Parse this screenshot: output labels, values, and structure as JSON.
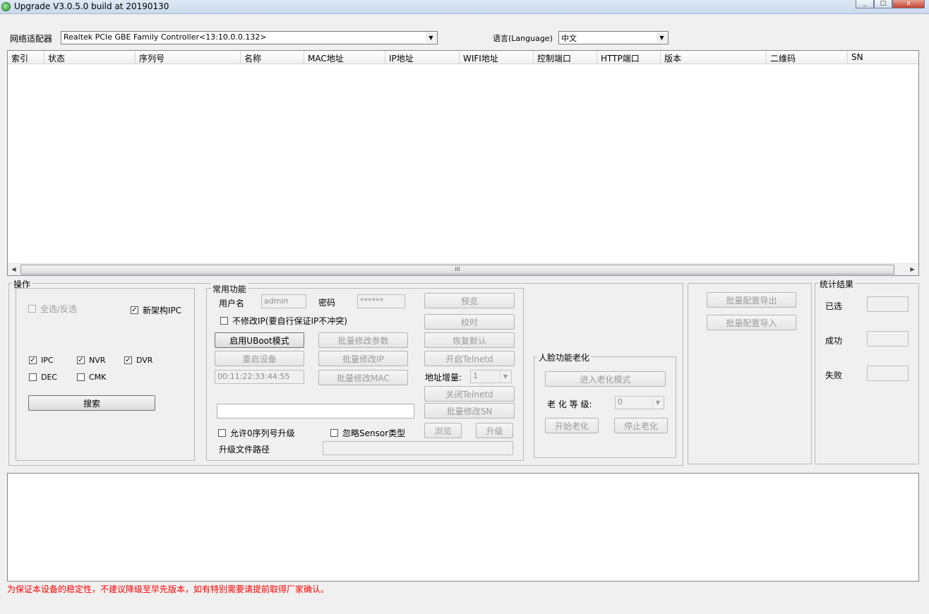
{
  "window": {
    "title": "Upgrade V3.0.5.0 build at 20190130",
    "controls": [
      "_",
      "□",
      "x"
    ]
  },
  "adapter": {
    "label": "网络适配器",
    "value": "Realtek PCIe GBE Family Controller<13:10.0.0.132>"
  },
  "language": {
    "label": "语言(Language)",
    "value": "中文"
  },
  "device_table": {
    "columns": [
      "索引",
      "状态",
      "序列号",
      "名称",
      "MAC地址",
      "IP地址",
      "WIFI地址",
      "控制端口",
      "HTTP端口",
      "版本",
      "二维码",
      "SN"
    ],
    "rows": [],
    "scroll_thumb_glyph": "III"
  },
  "operations": {
    "title": "操作",
    "select_all": {
      "label": "全选/反选",
      "checked": false,
      "enabled": false
    },
    "new_arch_ipc": {
      "label": "新架构IPC",
      "checked": true
    },
    "types": [
      {
        "label": "IPC",
        "checked": true
      },
      {
        "label": "NVR",
        "checked": true
      },
      {
        "label": "DVR",
        "checked": true
      },
      {
        "label": "DEC",
        "checked": false
      },
      {
        "label": "CMK",
        "checked": false
      }
    ],
    "search_button": "搜索"
  },
  "common": {
    "title": "常用功能",
    "username_label": "用户名",
    "username_value": "admin",
    "password_label": "密码",
    "password_value": "******",
    "no_modify_ip": {
      "label": "不修改IP(要自行保证IP不冲突)",
      "checked": false
    },
    "uboot_button": "启用UBoot模式",
    "batch_params_button": "批量修改参数",
    "restart_button": "重启设备",
    "batch_ip_button": "批量修改IP",
    "mac_value": "00:11:22:33:44:55",
    "batch_mac_button": "批量修改MAC",
    "preview_button": "预览",
    "sync_time_button": "校时",
    "restore_button": "恢复默认",
    "telnet_on_button": "开启Telnetd",
    "addr_increment_label": "地址增量:",
    "addr_increment_value": "1",
    "telnet_off_button": "关闭Telnetd",
    "batch_sn_button": "批量修改SN",
    "progress_value": "",
    "allow_zero_sn": {
      "label": "允许0序列号升级",
      "checked": false
    },
    "ignore_sensor": {
      "label": "忽略Sensor类型",
      "checked": false
    },
    "browse_button": "浏览",
    "upgrade_button": "升级",
    "file_path_label": "升级文件路径",
    "file_path_value": ""
  },
  "aging": {
    "title": "人脸功能老化",
    "enter_button": "进入老化模式",
    "level_label": "老 化 等 级:",
    "level_value": "0",
    "start_button": "开始老化",
    "stop_button": "停止老化"
  },
  "batch_config": {
    "export_button": "批量配置导出",
    "import_button": "批量配置导入"
  },
  "stats": {
    "title": "统计结果",
    "selected_label": "已选",
    "success_label": "成功",
    "fail_label": "失败",
    "selected_value": "",
    "success_value": "",
    "fail_value": ""
  },
  "log": {
    "text": ""
  },
  "warning_text": "为保证本设备的稳定性，不建议降级至早先版本，如有特别需要请提前取得厂家确认。",
  "colors": {
    "warning": "#ff0000",
    "background": "#f0f0f0",
    "disabled_text": "#9b9b9b"
  }
}
